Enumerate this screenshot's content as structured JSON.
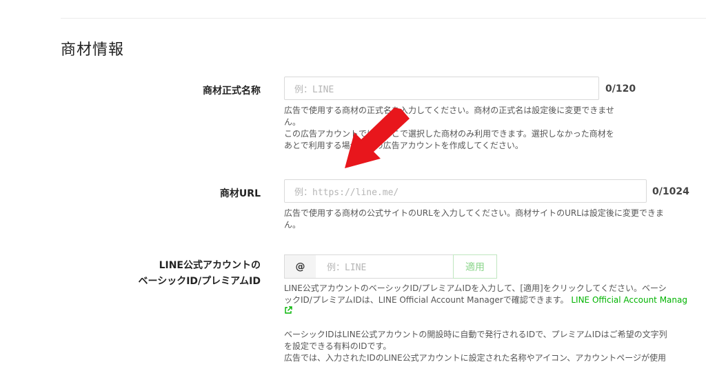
{
  "section": {
    "title": "商材情報"
  },
  "product_name": {
    "label": "商材正式名称",
    "placeholder": "例：LINE",
    "counter": "0/120",
    "help": [
      "広告で使用する商材の正式名を入力してください。商材の正式名は設定後に変更できませ",
      "ん。",
      "この広告アカウントでは、ここで選択した商材のみ利用できます。選択しなかった商材を",
      "あとで利用する場合は別の広告アカウントを作成してください。"
    ]
  },
  "product_url": {
    "label": "商材URL",
    "placeholder": "例：https://line.me/",
    "counter": "0/1024",
    "help": [
      "広告で使用する商材の公式サイトのURLを入力してください。商材サイトのURLは設定後に変更できま",
      "ん。"
    ]
  },
  "line_id": {
    "label_line1": "LINE公式アカウントの",
    "label_line2": "ベーシックID/プレミアムID",
    "prefix": "@",
    "placeholder": "例：LINE",
    "apply_label": "適用",
    "help_line1": "LINE公式アカウントのベーシックID/プレミアムIDを入力して、[適用]をクリックしてください。ベーシ",
    "help_line2": "ックID/プレミアムIDは、LINE Official Account Managerで確認できます。",
    "help_link": "LINE Official Account Manag",
    "help2": [
      "ベーシックIDはLINE公式アカウントの開設時に自動で発行されるIDで、プレミアムIDはご希望の文字列",
      "を設定できる有料のIDです。",
      "広告では、入力されたIDのLINE公式アカウントに設定された名称やアイコン、アカウントページが使用"
    ]
  },
  "colors": {
    "accent_green": "#00b300",
    "arrow_red": "#e8161c"
  }
}
